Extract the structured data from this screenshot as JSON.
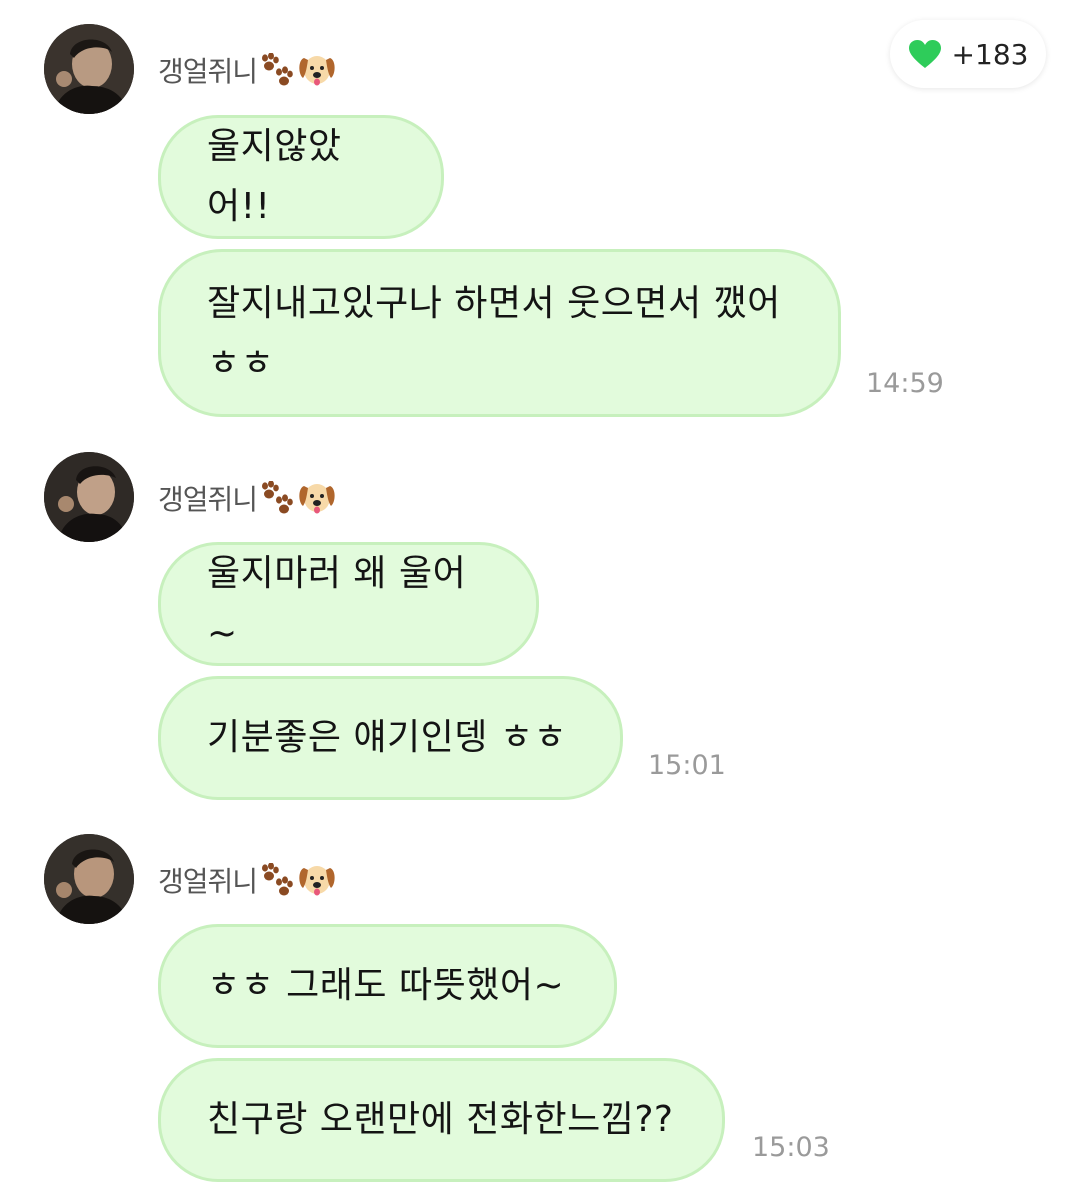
{
  "reactions": {
    "icon": "green-heart-icon",
    "color": "#2ecc5a",
    "count_label": "+183"
  },
  "messages": {
    "accent_bubble_bg": "#e2fbdc",
    "groups": [
      {
        "sender": "갱얼쥐니",
        "emojis": [
          "paw-prints-icon",
          "dog-face-icon"
        ],
        "bubbles": [
          "울지않았어!!",
          "잘지내고있구나 하면서 웃으면서 깼어\nㅎㅎ"
        ],
        "time": "14:59"
      },
      {
        "sender": "갱얼쥐니",
        "emojis": [
          "paw-prints-icon",
          "dog-face-icon"
        ],
        "bubbles": [
          "울지마러 왜 울어~",
          "기분좋은 얘기인뎅 ㅎㅎ"
        ],
        "time": "15:01"
      },
      {
        "sender": "갱얼쥐니",
        "emojis": [
          "paw-prints-icon",
          "dog-face-icon"
        ],
        "bubbles": [
          "ㅎㅎ 그래도 따뜻했어~",
          "친구랑 오랜만에 전화한느낌??"
        ],
        "time": "15:03"
      }
    ]
  }
}
